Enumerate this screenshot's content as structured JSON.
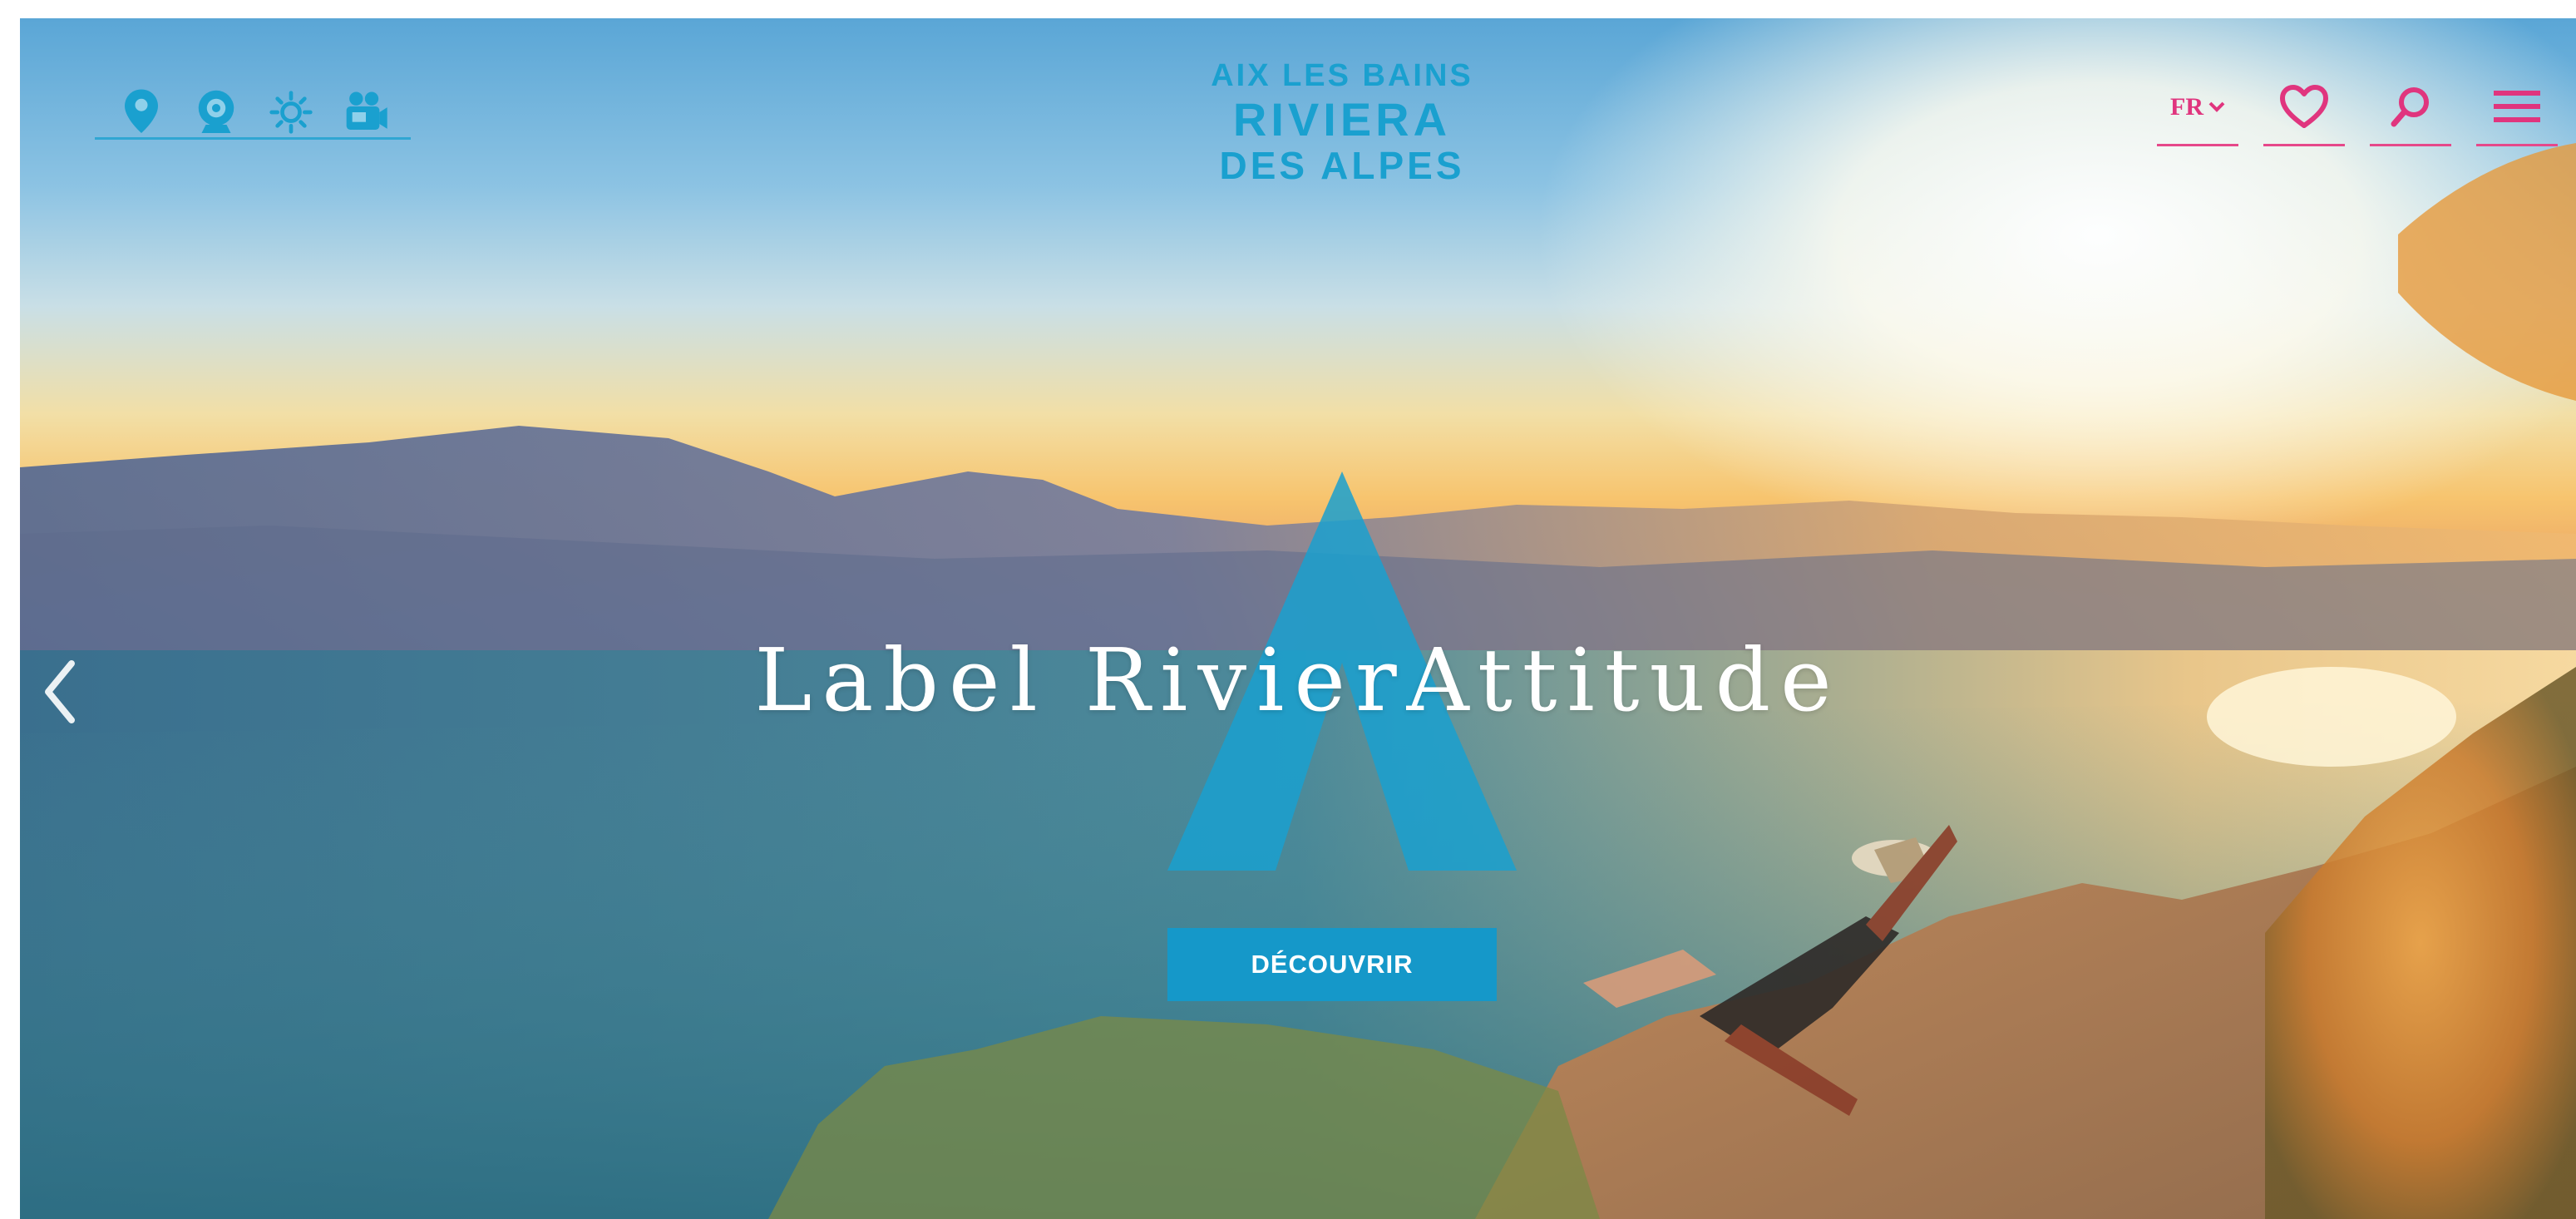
{
  "logo": {
    "line1": "AIX LES BAINS",
    "line2": "RIVIERA",
    "line3": "DES ALPES"
  },
  "top_icons": [
    "map-pin-icon",
    "webcam-icon",
    "sun-icon",
    "video-camera-icon"
  ],
  "top_right": {
    "language": "FR",
    "icons": [
      "heart-icon",
      "search-icon",
      "menu-icon"
    ]
  },
  "hero": {
    "title": "Label RivierAttitude",
    "cta_label": "DÉCOUVRIR"
  },
  "colors": {
    "brand_blue": "#1aa0cf",
    "brand_pink": "#e0357e",
    "cta_blue": "#1598c9"
  }
}
